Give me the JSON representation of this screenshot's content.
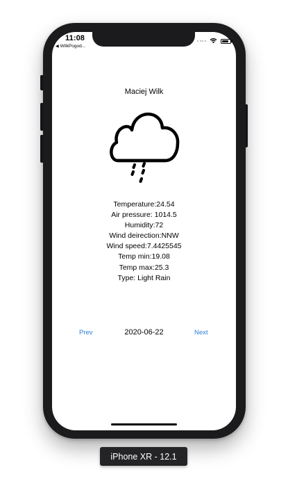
{
  "status_bar": {
    "time": "11:08",
    "back_app": "WilkPogod...",
    "icons": [
      "signal-icon",
      "wifi-icon",
      "battery-icon"
    ],
    "battery_level": 0.85
  },
  "app": {
    "author": "Maciej Wilk",
    "weather_icon": "rain-cloud-icon",
    "details": {
      "temperature": "Temperature:24.54",
      "air_pressure": "Air pressure: 1014.5",
      "humidity": "Humidity:72",
      "wind_direction": "Wind deirection:NNW",
      "wind_speed": "Wind speed:7.4425545",
      "temp_min": "Temp min:19.08",
      "temp_max": "Temp max:25.3",
      "type": "Type: Light Rain"
    },
    "nav": {
      "prev_label": "Prev",
      "date": "2020-06-22",
      "next_label": "Next"
    }
  },
  "simulator": {
    "device_label": "iPhone XR - 12.1"
  },
  "colors": {
    "link": "#2a7ed6",
    "device_frame": "#1b1b1d",
    "label_bg": "#242426"
  }
}
